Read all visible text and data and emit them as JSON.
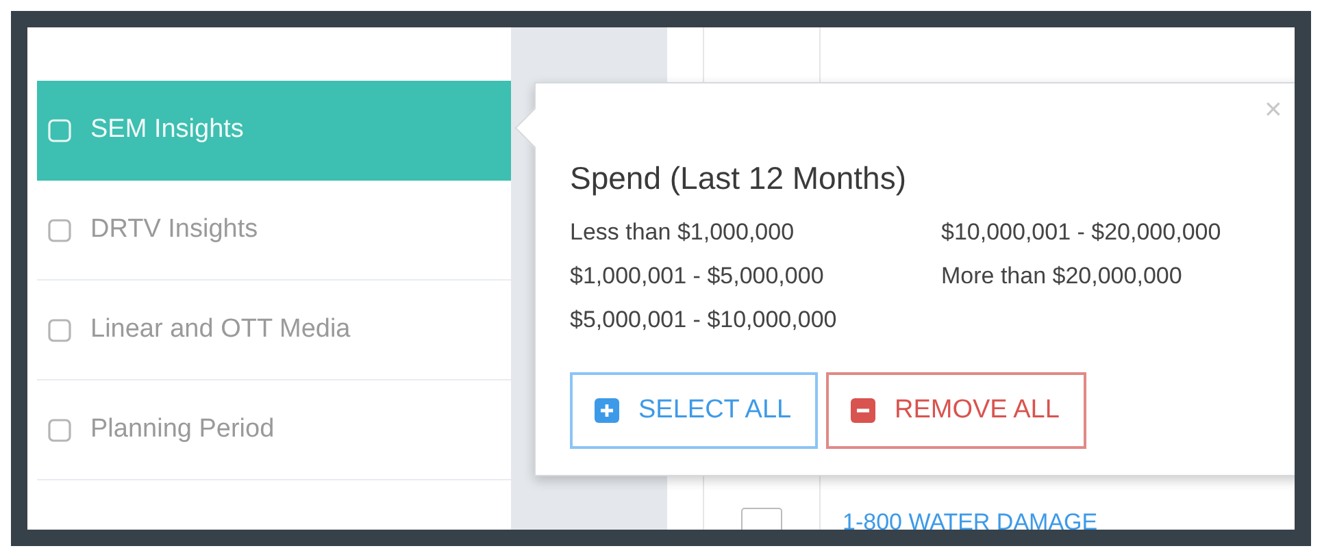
{
  "filters": [
    {
      "label": "SEM Insights",
      "selected": true,
      "checked": false
    },
    {
      "label": "DRTV Insights",
      "selected": false,
      "checked": false
    },
    {
      "label": "Linear and OTT Media",
      "selected": false,
      "checked": false
    },
    {
      "label": "Planning Period",
      "selected": false,
      "checked": false
    }
  ],
  "background_row": {
    "checked": false,
    "label": "1-800 WATER DAMAGE"
  },
  "popover": {
    "title": "Spend (Last 12 Months)",
    "close": "×",
    "options": [
      "Less than $1,000,000",
      "$1,000,001 - $5,000,000",
      "$5,000,001 - $10,000,000",
      "$10,000,001 - $20,000,000",
      "More than $20,000,000"
    ],
    "buttons": [
      {
        "kind": "select",
        "label": "SELECT ALL"
      },
      {
        "kind": "remove",
        "label": "REMOVE ALL"
      }
    ]
  }
}
